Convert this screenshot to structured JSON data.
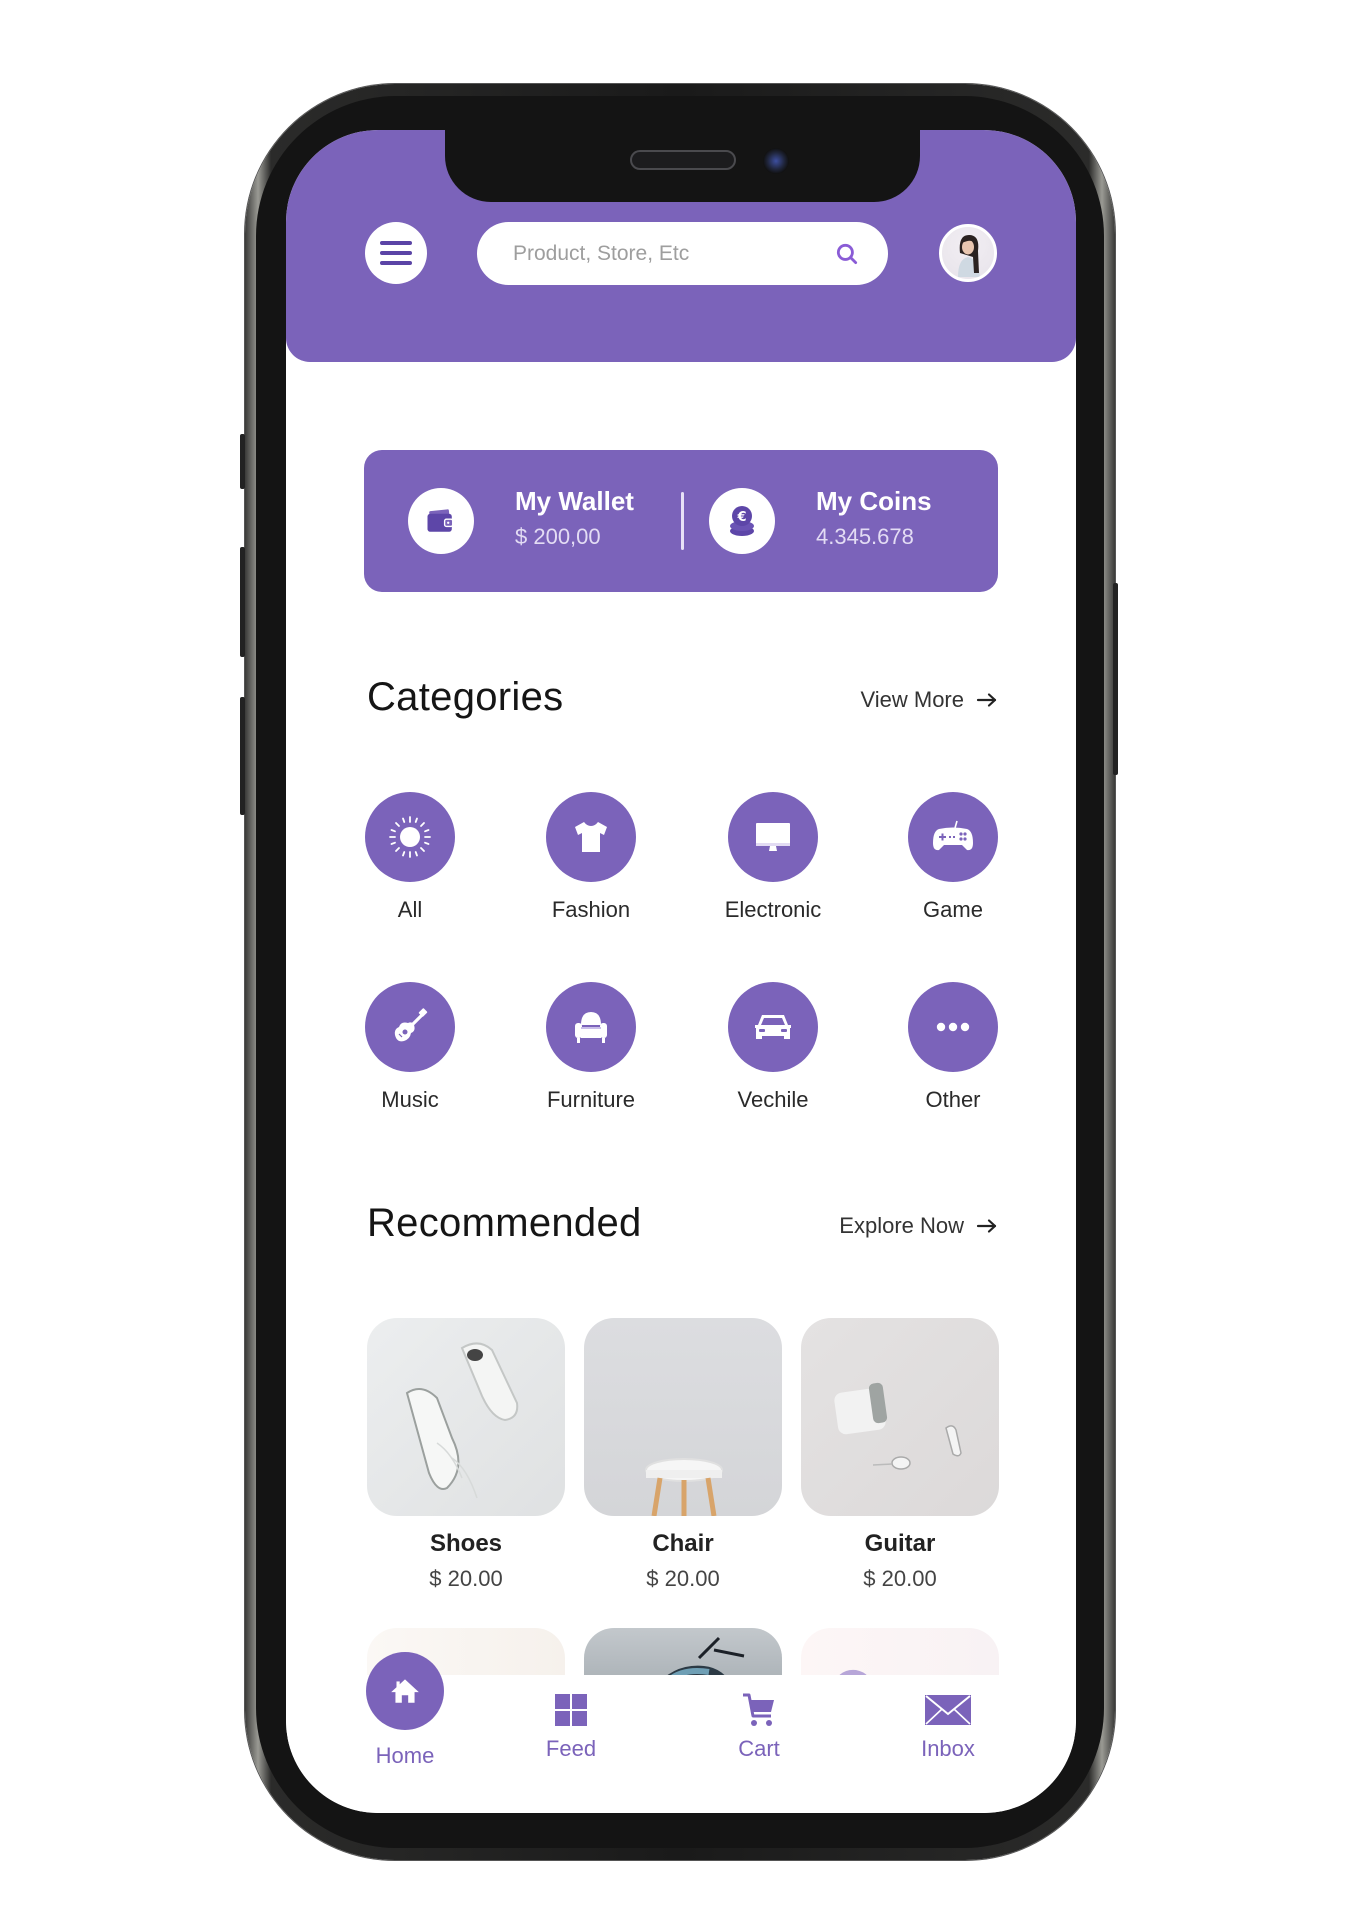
{
  "header": {
    "menu_icon": "hamburger-menu-icon",
    "search": {
      "placeholder": "Product, Store, Etc",
      "value": "",
      "icon": "search-icon"
    },
    "avatar_icon": "user-avatar"
  },
  "wallet": {
    "wallet_title": "My Wallet",
    "wallet_value": "$ 200,00",
    "wallet_icon": "wallet-icon",
    "coins_title": "My Coins",
    "coins_value": "4.345.678",
    "coins_icon": "euro-coins-icon"
  },
  "categories": {
    "title": "Categories",
    "link": "View More",
    "items": [
      {
        "label": "All",
        "icon": "sun-icon"
      },
      {
        "label": "Fashion",
        "icon": "tshirt-icon"
      },
      {
        "label": "Electronic",
        "icon": "monitor-icon"
      },
      {
        "label": "Game",
        "icon": "gamepad-icon"
      },
      {
        "label": "Music",
        "icon": "guitar-icon"
      },
      {
        "label": "Furniture",
        "icon": "armchair-icon"
      },
      {
        "label": "Vechile",
        "icon": "car-icon"
      },
      {
        "label": "Other",
        "icon": "more-dots-icon"
      }
    ]
  },
  "recommended": {
    "title": "Recommended",
    "link": "Explore Now",
    "products": [
      {
        "name": "Shoes",
        "price": "$ 20.00"
      },
      {
        "name": "Chair",
        "price": "$ 20.00"
      },
      {
        "name": "Guitar",
        "price": "$ 20.00"
      }
    ]
  },
  "bottom_nav": {
    "items": [
      {
        "label": "Home",
        "icon": "home-icon",
        "active": true
      },
      {
        "label": "Feed",
        "icon": "grid-icon",
        "active": false
      },
      {
        "label": "Cart",
        "icon": "cart-icon",
        "active": false
      },
      {
        "label": "Inbox",
        "icon": "envelope-icon",
        "active": false
      }
    ]
  },
  "colors": {
    "primary": "#7b63ba",
    "text_dark": "#151515",
    "background": "#ffffff"
  }
}
